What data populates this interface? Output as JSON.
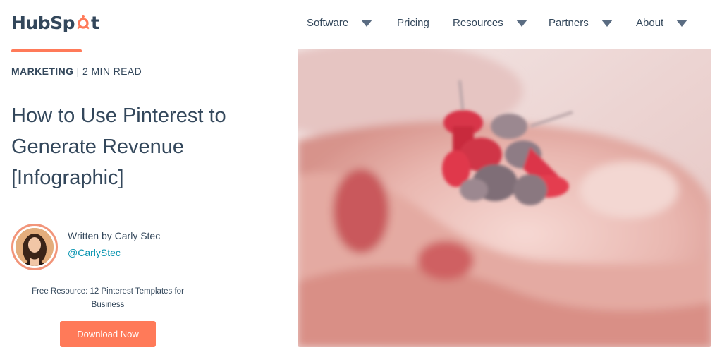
{
  "brand": {
    "name_part1": "HubSp",
    "name_part2": "t",
    "accent": "#ff7a59",
    "text": "#33475b"
  },
  "nav": [
    {
      "label": "Software",
      "has_dropdown": true
    },
    {
      "label": "Pricing",
      "has_dropdown": false
    },
    {
      "label": "Resources",
      "has_dropdown": true
    },
    {
      "label": "Partners",
      "has_dropdown": true
    },
    {
      "label": "About",
      "has_dropdown": true
    }
  ],
  "article": {
    "category": "MARKETING",
    "separator": " | ",
    "read_time": "2 MIN READ",
    "title": "How to Use Pinterest to Generate Revenue [Infographic]"
  },
  "author": {
    "written_by": "Written by Carly Stec",
    "handle": "@CarlyStec"
  },
  "resource": {
    "text": "Free Resource: 12 Pinterest Templates for Business",
    "button_label": "Download Now"
  },
  "hero": {
    "icon": "pushpins-in-hand-photo"
  }
}
